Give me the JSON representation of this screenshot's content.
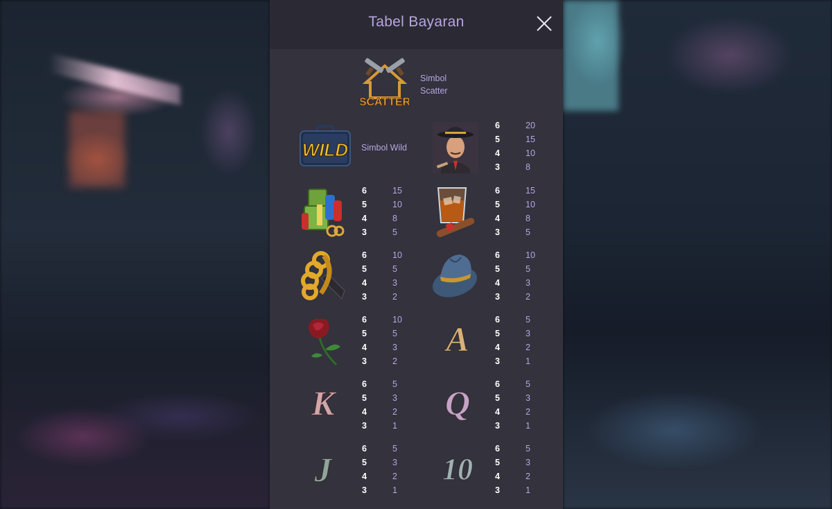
{
  "paytable": {
    "title": "Tabel Bayaran",
    "close_icon": "close-icon",
    "scatter": {
      "icon": "scatter-guns-icon",
      "badge": "SCATTER",
      "label_line1": "Simbol",
      "label_line2": "Scatter"
    },
    "wild": {
      "icon": "wild-briefcase-icon",
      "badge": "WILD",
      "label": "Simbol Wild"
    },
    "symbols": [
      {
        "id": "gangster",
        "icon": "gangster-portrait-icon",
        "pays": [
          [
            "6",
            "20"
          ],
          [
            "5",
            "15"
          ],
          [
            "4",
            "10"
          ],
          [
            "3",
            "8"
          ]
        ]
      },
      {
        "id": "money",
        "icon": "money-chips-icon",
        "pays": [
          [
            "6",
            "15"
          ],
          [
            "5",
            "10"
          ],
          [
            "4",
            "8"
          ],
          [
            "3",
            "5"
          ]
        ]
      },
      {
        "id": "whiskey",
        "icon": "whiskey-cigar-icon",
        "pays": [
          [
            "6",
            "15"
          ],
          [
            "5",
            "10"
          ],
          [
            "4",
            "8"
          ],
          [
            "3",
            "5"
          ]
        ]
      },
      {
        "id": "knuckles",
        "icon": "brass-knuckles-icon",
        "pays": [
          [
            "6",
            "10"
          ],
          [
            "5",
            "5"
          ],
          [
            "4",
            "3"
          ],
          [
            "3",
            "2"
          ]
        ]
      },
      {
        "id": "hat",
        "icon": "fedora-hat-icon",
        "pays": [
          [
            "6",
            "10"
          ],
          [
            "5",
            "5"
          ],
          [
            "4",
            "3"
          ],
          [
            "3",
            "2"
          ]
        ]
      },
      {
        "id": "rose",
        "icon": "rose-icon",
        "pays": [
          [
            "6",
            "10"
          ],
          [
            "5",
            "5"
          ],
          [
            "4",
            "3"
          ],
          [
            "3",
            "2"
          ]
        ]
      },
      {
        "id": "ace",
        "icon": "letter-a-icon",
        "glyph": "A",
        "pays": [
          [
            "6",
            "5"
          ],
          [
            "5",
            "3"
          ],
          [
            "4",
            "2"
          ],
          [
            "3",
            "1"
          ]
        ]
      },
      {
        "id": "king",
        "icon": "letter-k-icon",
        "glyph": "K",
        "pays": [
          [
            "6",
            "5"
          ],
          [
            "5",
            "3"
          ],
          [
            "4",
            "2"
          ],
          [
            "3",
            "1"
          ]
        ]
      },
      {
        "id": "queen",
        "icon": "letter-q-icon",
        "glyph": "Q",
        "pays": [
          [
            "6",
            "5"
          ],
          [
            "5",
            "3"
          ],
          [
            "4",
            "2"
          ],
          [
            "3",
            "1"
          ]
        ]
      },
      {
        "id": "jack",
        "icon": "letter-j-icon",
        "glyph": "J",
        "pays": [
          [
            "6",
            "5"
          ],
          [
            "5",
            "3"
          ],
          [
            "4",
            "2"
          ],
          [
            "3",
            "1"
          ]
        ]
      },
      {
        "id": "ten",
        "icon": "number-10-icon",
        "glyph": "10",
        "pays": [
          [
            "6",
            "5"
          ],
          [
            "5",
            "3"
          ],
          [
            "4",
            "2"
          ],
          [
            "3",
            "1"
          ]
        ]
      }
    ]
  },
  "colors": {
    "panel": "#33323d",
    "header": "#2b2a34",
    "accent": "#b8a6e0",
    "count": "#ffffff",
    "gold": "#e0a83a"
  }
}
